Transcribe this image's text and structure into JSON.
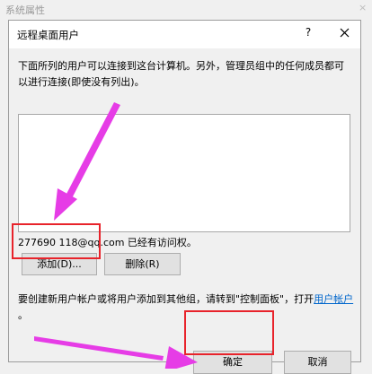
{
  "parent_window": {
    "title": "系统属性",
    "close_glyph": "×"
  },
  "dialog": {
    "title": "远程桌面用户",
    "help_label": "?",
    "description": "下面所列的用户可以连接到这台计算机。另外，管理员组中的任何成员都可以进行连接(即使没有列出)。",
    "access_text": "277690 118@qq.com 已经有访问权。",
    "add_button": "添加(D)...",
    "remove_button": "删除(R)",
    "info_text": "要创建新用户帐户或将用户添加到其他组，请转到\"控制面板\"，打开",
    "info_link": "用户帐户",
    "info_end": "。",
    "ok_button": "确定",
    "cancel_button": "取消"
  },
  "colors": {
    "highlight": "#e8232b",
    "arrow": "#e63ce6",
    "link": "#0066cc"
  },
  "icons": [
    "close-icon",
    "help-icon",
    "pointer-arrow"
  ]
}
